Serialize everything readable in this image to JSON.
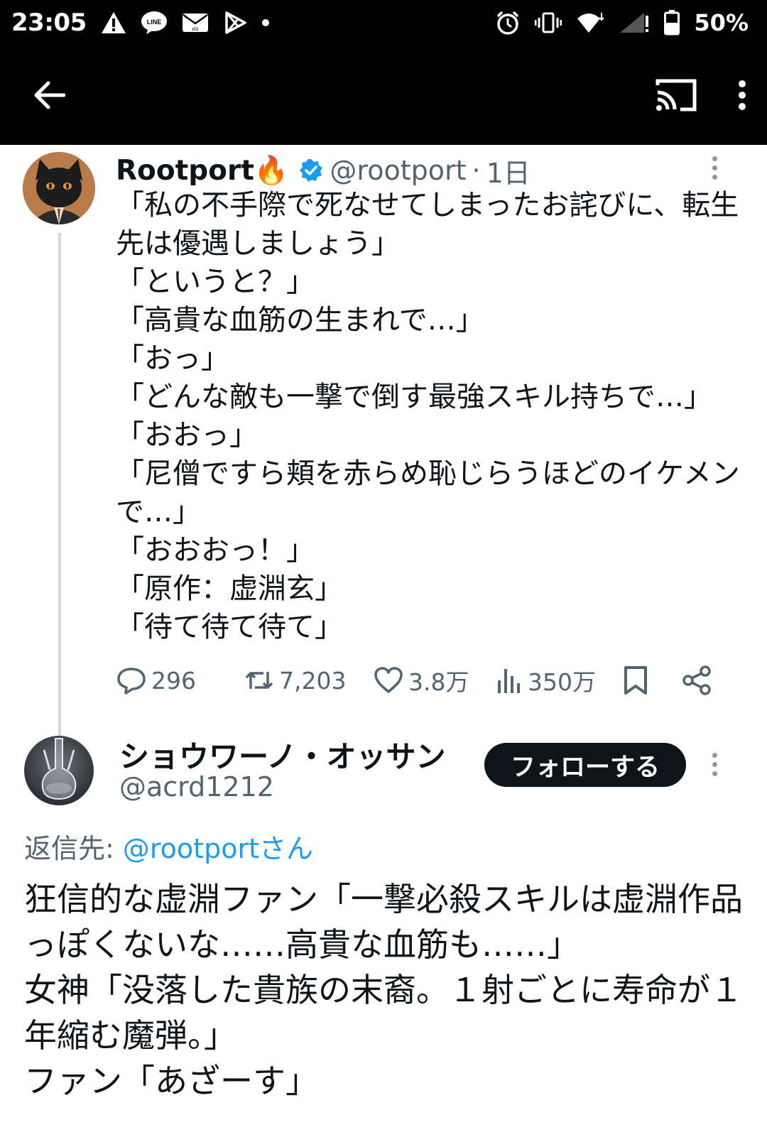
{
  "status_bar": {
    "time": "23:05",
    "battery": "50%",
    "notification_icons": [
      "warning-icon",
      "line-icon",
      "au-mail-icon",
      "play-store-icon",
      "dot-icon"
    ],
    "system_icons": [
      "alarm-icon",
      "vibrate-icon",
      "wifi-icon",
      "signal-icon",
      "battery-icon"
    ]
  },
  "app_bar": {
    "icons": [
      "back-arrow-icon",
      "cast-icon",
      "overflow-menu-icon"
    ]
  },
  "tweet": {
    "author": "Rootport🔥",
    "handle": "@rootport",
    "separator": "·",
    "time": "1日",
    "verified": true,
    "text": "「私の不手際で死なせてしまったお詫びに、転生先は優遇しましょう」\n「というと？」\n「高貴な血筋の生まれで…」\n「おっ」\n「どんな敵も一撃で倒す最強スキル持ちで…」\n「おおっ」\n「尼僧ですら頬を赤らめ恥じらうほどのイケメンで…」\n「おおおっ！」\n「原作：虚淵玄」\n「待て待て待て」",
    "stats": {
      "replies": "296",
      "retweets": "7,203",
      "likes": "3.8万",
      "views": "350万"
    }
  },
  "reply": {
    "author": "ショウワーノ・オッサン",
    "handle": "@acrd1212",
    "follow_label": "フォローする",
    "replying_prefix": "返信先: ",
    "replying_to": "@rootportさん",
    "text": "狂信的な虚淵ファン「一撃必殺スキルは虚淵作品っぽくないな……高貴な血筋も……」\n女神「没落した貴族の末裔。１射ごとに寿命が１年縮む魔弾。」\nファン「あざーす」"
  },
  "colors": {
    "accent": "#1d9bf0",
    "text_primary": "#0f1419",
    "text_secondary": "#536471",
    "bar_background": "#000000",
    "thread_line": "#cfd9de"
  }
}
